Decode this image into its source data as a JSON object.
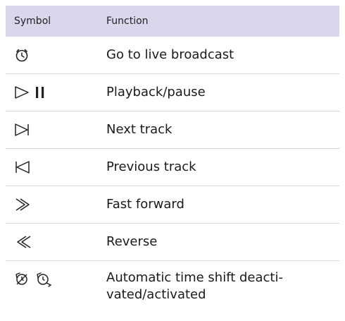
{
  "table": {
    "header": {
      "symbol": "Symbol",
      "function": "Function"
    },
    "rows": [
      {
        "icon": "clock-icon",
        "function": "Go to live broadcast"
      },
      {
        "icon": "play-pause-icon",
        "function": "Playback/pause"
      },
      {
        "icon": "next-track-icon",
        "function": "Next track"
      },
      {
        "icon": "previous-track-icon",
        "function": "Previous track"
      },
      {
        "icon": "fast-forward-icon",
        "function": "Fast forward"
      },
      {
        "icon": "reverse-icon",
        "function": "Reverse"
      },
      {
        "icon": "time-shift-icon",
        "function": "Automatic time shift deacti-\nvated/activated"
      }
    ]
  },
  "colors": {
    "header_bg": "#dcd6ec",
    "divider": "#d7d7d7",
    "text": "#1a1a1a"
  }
}
